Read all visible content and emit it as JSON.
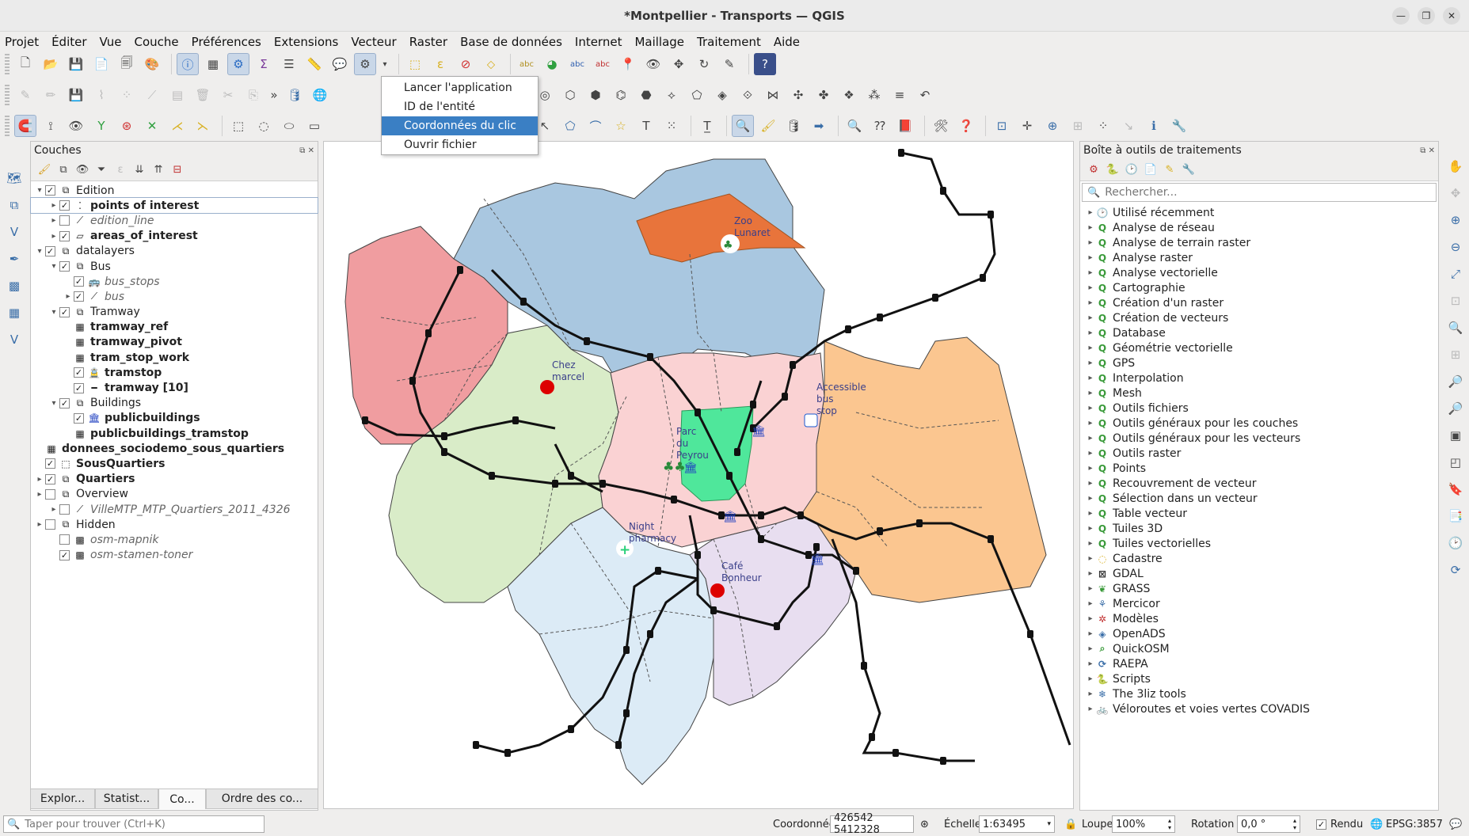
{
  "window": {
    "title": "*Montpellier - Transports — QGIS"
  },
  "menu": [
    "Projet",
    "Éditer",
    "Vue",
    "Couche",
    "Préférences",
    "Extensions",
    "Vecteur",
    "Raster",
    "Base de données",
    "Internet",
    "Maillage",
    "Traitement",
    "Aide"
  ],
  "actions_menu": {
    "items": [
      "Lancer l'application",
      "ID de l'entité",
      "Coordonnées du clic",
      "Ouvrir fichier"
    ],
    "highlighted": "Coordonnées du clic"
  },
  "layers_panel": {
    "title": "Couches",
    "items": [
      {
        "label": "Edition",
        "level": 0,
        "type": "group",
        "checked": true,
        "expanded": true,
        "bold": false
      },
      {
        "label": "points of interest",
        "level": 1,
        "type": "point",
        "checked": true,
        "bold": true,
        "selected": true
      },
      {
        "label": "edition_line",
        "level": 1,
        "type": "line",
        "checked": false,
        "italic": true
      },
      {
        "label": "areas_of_interest",
        "level": 1,
        "type": "polygon",
        "checked": true,
        "bold": true
      },
      {
        "label": "datalayers",
        "level": 0,
        "type": "group",
        "checked": true,
        "expanded": true
      },
      {
        "label": "Bus",
        "level": 1,
        "type": "group",
        "checked": true,
        "expanded": true
      },
      {
        "label": "bus_stops",
        "level": 2,
        "type": "bus",
        "checked": true,
        "italic": true
      },
      {
        "label": "bus",
        "level": 2,
        "type": "line",
        "checked": true,
        "italic": true
      },
      {
        "label": "Tramway",
        "level": 1,
        "type": "group",
        "checked": true,
        "expanded": true
      },
      {
        "label": "tramway_ref",
        "level": 2,
        "type": "table",
        "bold": true
      },
      {
        "label": "tramway_pivot",
        "level": 2,
        "type": "table",
        "bold": true
      },
      {
        "label": "tram_stop_work",
        "level": 2,
        "type": "table",
        "bold": true
      },
      {
        "label": "tramstop",
        "level": 2,
        "type": "tram",
        "checked": true,
        "bold": true
      },
      {
        "label": "tramway [10]",
        "level": 2,
        "type": "tramline",
        "checked": true,
        "bold": true
      },
      {
        "label": "Buildings",
        "level": 1,
        "type": "group",
        "checked": true,
        "expanded": true
      },
      {
        "label": "publicbuildings",
        "level": 2,
        "type": "building",
        "checked": true,
        "bold": true
      },
      {
        "label": "publicbuildings_tramstop",
        "level": 2,
        "type": "table",
        "bold": true
      },
      {
        "label": "donnees_sociodemo_sous_quartiers",
        "level": 0,
        "type": "table",
        "bold": true
      },
      {
        "label": "SousQuartiers",
        "level": 0,
        "type": "dashpoly",
        "checked": true,
        "bold": true
      },
      {
        "label": "Quartiers",
        "level": 0,
        "type": "group",
        "checked": true,
        "bold": true
      },
      {
        "label": "Overview",
        "level": 0,
        "type": "group",
        "checked": false
      },
      {
        "label": "VilleMTP_MTP_Quartiers_2011_4326",
        "level": 1,
        "type": "line",
        "checked": false,
        "italic": true
      },
      {
        "label": "Hidden",
        "level": 0,
        "type": "group",
        "checked": false
      },
      {
        "label": "osm-mapnik",
        "level": 1,
        "type": "raster",
        "checked": false,
        "italic": true
      },
      {
        "label": "osm-stamen-toner",
        "level": 1,
        "type": "raster",
        "checked": true,
        "italic": true
      }
    ],
    "tabs": [
      "Explor...",
      "Statist...",
      "Co...",
      "Ordre des co..."
    ],
    "active_tab": "Co..."
  },
  "toolbox": {
    "title": "Boîte à outils de traitements",
    "search_placeholder": "Rechercher...",
    "items": [
      {
        "label": "Utilisé récemment",
        "icon": "clock-icon"
      },
      {
        "label": "Analyse de réseau",
        "icon": "qgis-icon"
      },
      {
        "label": "Analyse de terrain raster",
        "icon": "qgis-icon"
      },
      {
        "label": "Analyse raster",
        "icon": "qgis-icon"
      },
      {
        "label": "Analyse vectorielle",
        "icon": "qgis-icon"
      },
      {
        "label": "Cartographie",
        "icon": "qgis-icon"
      },
      {
        "label": "Création d'un raster",
        "icon": "qgis-icon"
      },
      {
        "label": "Création de vecteurs",
        "icon": "qgis-icon"
      },
      {
        "label": "Database",
        "icon": "qgis-icon"
      },
      {
        "label": "Géométrie vectorielle",
        "icon": "qgis-icon"
      },
      {
        "label": "GPS",
        "icon": "qgis-icon"
      },
      {
        "label": "Interpolation",
        "icon": "qgis-icon"
      },
      {
        "label": "Mesh",
        "icon": "qgis-icon"
      },
      {
        "label": "Outils fichiers",
        "icon": "qgis-icon"
      },
      {
        "label": "Outils généraux pour les couches",
        "icon": "qgis-icon"
      },
      {
        "label": "Outils généraux pour les vecteurs",
        "icon": "qgis-icon"
      },
      {
        "label": "Outils raster",
        "icon": "qgis-icon"
      },
      {
        "label": "Points",
        "icon": "qgis-icon"
      },
      {
        "label": "Recouvrement de vecteur",
        "icon": "qgis-icon"
      },
      {
        "label": "Sélection dans un vecteur",
        "icon": "qgis-icon"
      },
      {
        "label": "Table vecteur",
        "icon": "qgis-icon"
      },
      {
        "label": "Tuiles 3D",
        "icon": "qgis-icon"
      },
      {
        "label": "Tuiles vectorielles",
        "icon": "qgis-icon"
      },
      {
        "label": "Cadastre",
        "icon": "cadastre-icon"
      },
      {
        "label": "GDAL",
        "icon": "gdal-icon"
      },
      {
        "label": "GRASS",
        "icon": "grass-icon"
      },
      {
        "label": "Mercicor",
        "icon": "coral-icon"
      },
      {
        "label": "Modèles",
        "icon": "model-icon"
      },
      {
        "label": "OpenADS",
        "icon": "openads-icon"
      },
      {
        "label": "QuickOSM",
        "icon": "quickosm-icon"
      },
      {
        "label": "RAEPA",
        "icon": "raepa-icon"
      },
      {
        "label": "Scripts",
        "icon": "python-icon"
      },
      {
        "label": "The 3liz tools",
        "icon": "gear-icon"
      },
      {
        "label": "Véloroutes et voies vertes COVADIS",
        "icon": "bike-icon"
      }
    ]
  },
  "map_labels": {
    "zoo": "Zoo\nLunaret",
    "chez": "Chez\nmarcel",
    "accessible": "Accessible\nbus\nstop",
    "parc": "Parc\ndu\nPeyrou",
    "night": "Night\npharmacy",
    "cafe": "Café\nBonheur"
  },
  "status": {
    "search_placeholder": "Taper pour trouver (Ctrl+K)",
    "coord_label": "Coordonnée",
    "coord_value": "426542  5412328",
    "scale_label": "Échelle",
    "scale_value": "1:63495",
    "zoom_label": "Loupe",
    "zoom_value": "100%",
    "rotation_label": "Rotation",
    "rotation_value": "0,0 °",
    "render_label": "Rendu",
    "crs": "EPSG:3857"
  },
  "colors": {
    "accent": "#3a7fc4",
    "zoo": "#e8743b",
    "district_red": "#f09da0",
    "district_blue": "#a9c7e0",
    "district_orange": "#fbc690",
    "district_green": "#d9ecc8",
    "district_pink": "#fad2d3",
    "park": "#4fe79b",
    "district_lightblue": "#dcebf6",
    "district_lavender": "#e8def0"
  }
}
